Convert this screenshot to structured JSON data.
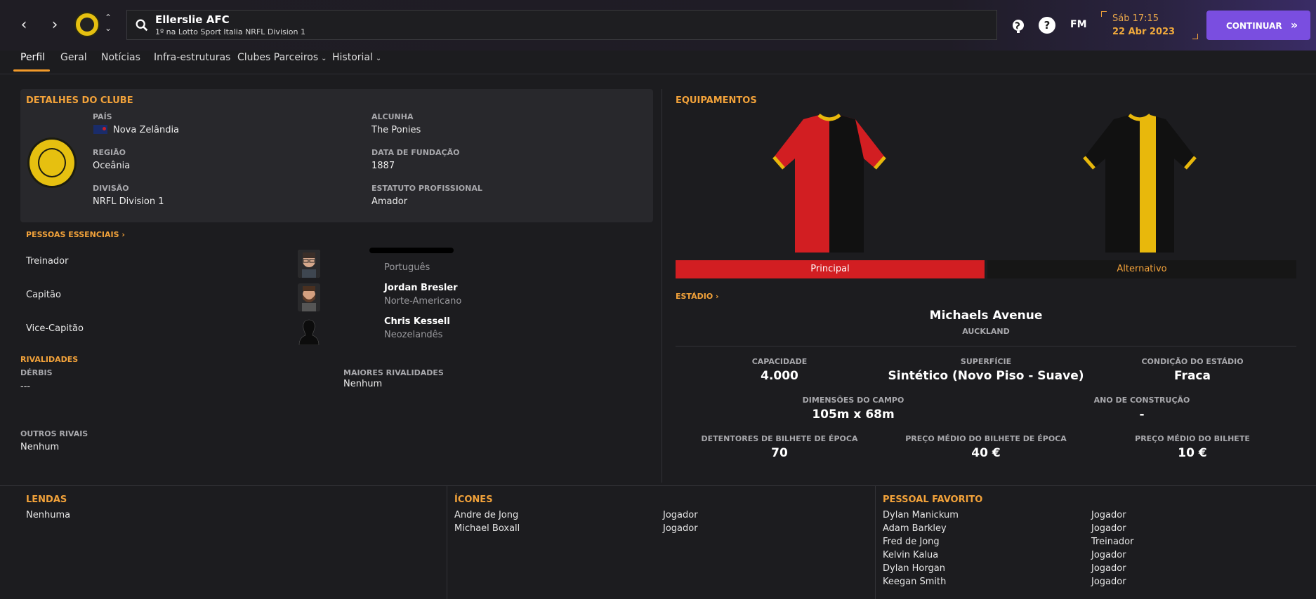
{
  "header": {
    "club_name": "Ellerslie AFC",
    "league_position": "1º na Lotto Sport Italia NRFL Division 1",
    "fm_label": "FM",
    "help_symbol": "?",
    "date_line1": "Sáb 17:15",
    "date_line2": "22 Abr 2023",
    "continue_label": "CONTINUAR",
    "icons": [
      "chevron-left-icon",
      "chevron-right-icon",
      "club-crest-icon",
      "sort-updown-icon",
      "search-icon",
      "globe-icon",
      "help-icon",
      "fm-logo"
    ]
  },
  "tabs": [
    {
      "label": "Perfil",
      "active": true
    },
    {
      "label": "Geral"
    },
    {
      "label": "Notícias"
    },
    {
      "label": "Infra-estruturas"
    },
    {
      "label": "Clubes Parceiros",
      "has_dropdown": true
    },
    {
      "label": "Historial",
      "has_dropdown": true
    }
  ],
  "details": {
    "title": "DETALHES DO CLUBE",
    "country_label": "PAÍS",
    "country": "Nova Zelândia",
    "region_label": "REGIÃO",
    "region": "Oceânia",
    "division_label": "DIVISÃO",
    "division": "NRFL Division 1",
    "nickname_label": "ALCUNHA",
    "nickname": "The Ponies",
    "founded_label": "DATA DE FUNDAÇÃO",
    "founded": "1887",
    "status_label": "ESTATUTO PROFISSIONAL",
    "status": "Amador"
  },
  "key_people": {
    "title": "PESSOAS ESSENCIAIS",
    "rows": [
      {
        "role": "Treinador",
        "name": "",
        "nationality": "Português"
      },
      {
        "role": "Capitão",
        "name": "Jordan Bresler",
        "nationality": "Norte-Americano"
      },
      {
        "role": "Vice-Capitão",
        "name": "Chris Kessell",
        "nationality": "Neozelandês"
      }
    ]
  },
  "rivalries": {
    "title": "RIVALIDADES",
    "derbies_label": "DÉRBIS",
    "derbies": "---",
    "major_label": "MAIORES RIVALIDADES",
    "major": "Nenhum",
    "other_label": "OUTROS RIVAIS",
    "other": "Nenhum"
  },
  "kits": {
    "title": "EQUIPAMENTOS",
    "home_label": "Principal",
    "away_label": "Alternativo",
    "home_colors": [
      "#d21e22",
      "#111111"
    ],
    "away_colors": [
      "#111111",
      "#e8b80c"
    ]
  },
  "stadium": {
    "title": "ESTÁDIO",
    "name": "Michaels Avenue",
    "city": "AUCKLAND",
    "capacity_label": "CAPACIDADE",
    "capacity": "4.000",
    "surface_label": "SUPERFÍCIE",
    "surface": "Sintético (Novo Piso - Suave)",
    "condition_label": "CONDIÇÃO DO ESTÁDIO",
    "condition": "Fraca",
    "dimensions_label": "DIMENSÕES DO CAMPO",
    "dimensions": "105m x 68m",
    "built_label": "ANO DE CONSTRUÇÃO",
    "built": "-",
    "season_holders_label": "DETENTORES DE BILHETE DE ÉPOCA",
    "season_holders": "70",
    "season_price_label": "PREÇO MÉDIO DO BILHETE DE ÉPOCA",
    "season_price": "40 €",
    "ticket_price_label": "PREÇO MÉDIO DO BILHETE",
    "ticket_price": "10 €"
  },
  "legends": {
    "title": "LENDAS",
    "value": "Nenhuma"
  },
  "icons_section": {
    "title": "ÍCONES",
    "rows": [
      {
        "name": "Andre de Jong",
        "role": "Jogador"
      },
      {
        "name": "Michael Boxall",
        "role": "Jogador"
      }
    ]
  },
  "favourites": {
    "title": "PESSOAL FAVORITO",
    "rows": [
      {
        "name": "Dylan Manickum",
        "role": "Jogador"
      },
      {
        "name": "Adam Barkley",
        "role": "Jogador"
      },
      {
        "name": "Fred de Jong",
        "role": "Treinador"
      },
      {
        "name": "Kelvin Kalua",
        "role": "Jogador"
      },
      {
        "name": "Dylan Horgan",
        "role": "Jogador"
      },
      {
        "name": "Keegan Smith",
        "role": "Jogador"
      }
    ]
  },
  "colors": {
    "accent": "#f2a23a",
    "continue_button": "#7a4ee0",
    "home_bar": "#d21e22"
  }
}
